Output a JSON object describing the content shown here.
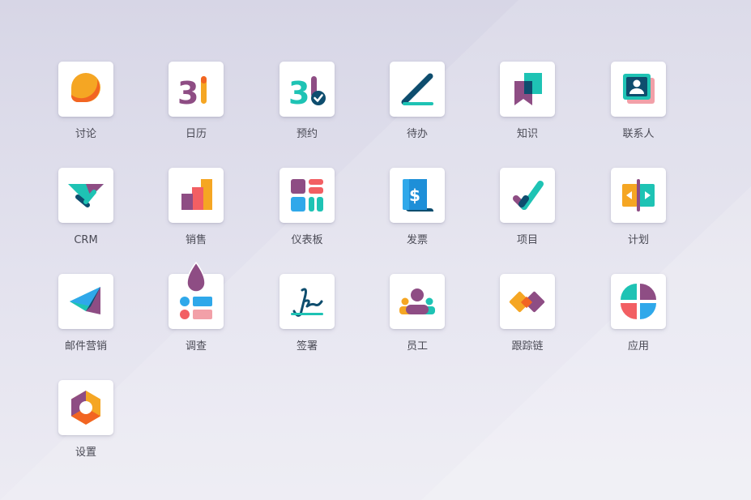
{
  "apps": [
    {
      "label": "讨论",
      "icon": "discuss-icon"
    },
    {
      "label": "日历",
      "icon": "calendar-icon"
    },
    {
      "label": "预约",
      "icon": "appointment-icon"
    },
    {
      "label": "待办",
      "icon": "todo-icon"
    },
    {
      "label": "知识",
      "icon": "knowledge-icon"
    },
    {
      "label": "联系人",
      "icon": "contacts-icon"
    },
    {
      "label": "CRM",
      "icon": "crm-icon"
    },
    {
      "label": "销售",
      "icon": "sales-icon"
    },
    {
      "label": "仪表板",
      "icon": "dashboard-icon"
    },
    {
      "label": "发票",
      "icon": "invoice-icon"
    },
    {
      "label": "项目",
      "icon": "project-icon"
    },
    {
      "label": "计划",
      "icon": "planning-icon"
    },
    {
      "label": "邮件营销",
      "icon": "email-marketing-icon"
    },
    {
      "label": "调查",
      "icon": "survey-icon"
    },
    {
      "label": "签署",
      "icon": "sign-icon"
    },
    {
      "label": "员工",
      "icon": "employees-icon"
    },
    {
      "label": "跟踪链",
      "icon": "link-tracker-icon"
    },
    {
      "label": "应用",
      "icon": "apps-icon"
    },
    {
      "label": "设置",
      "icon": "settings-icon"
    }
  ],
  "colors": {
    "background": "#dcdbe8",
    "tile": "#ffffff",
    "label": "#4a4a55",
    "teal": "#1ec3b4",
    "purple": "#8e4d84",
    "orange": "#f5a623",
    "navy": "#0e4d6e",
    "coral": "#f25f63",
    "blue": "#2fa8ea"
  },
  "calendar_day": "31"
}
